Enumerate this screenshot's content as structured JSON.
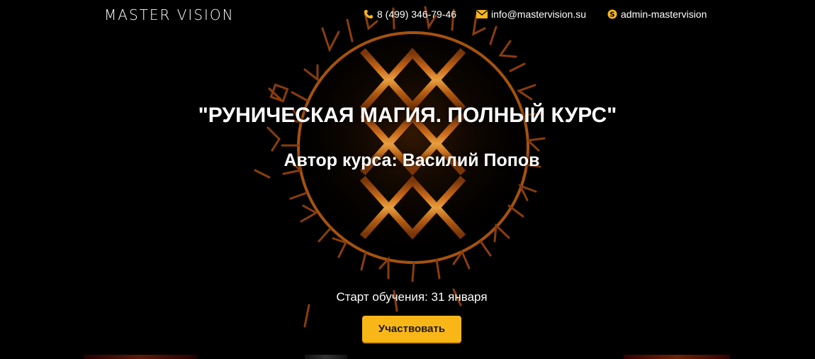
{
  "header": {
    "logo_text": "MASTER VISION",
    "phone": "8 (499) 346-79-46",
    "email": "info@mastervision.su",
    "skype": "admin-mastervision"
  },
  "hero": {
    "title": "\"РУНИЧЕСКАЯ МАГИЯ. ПОЛНЫЙ КУРС\"",
    "author": "Автор курса: Василий Попов",
    "start_date": "Старт обучения: 31 января",
    "cta_label": "Участвовать"
  },
  "icons": {
    "phone": "phone-icon",
    "email": "envelope-icon",
    "skype": "skype-icon",
    "background": "runic-circle-icon"
  },
  "colors": {
    "background": "#000000",
    "accent": "#f8b717",
    "rune_orange": "#d4761c",
    "rune_dark": "#8a3d0c"
  }
}
